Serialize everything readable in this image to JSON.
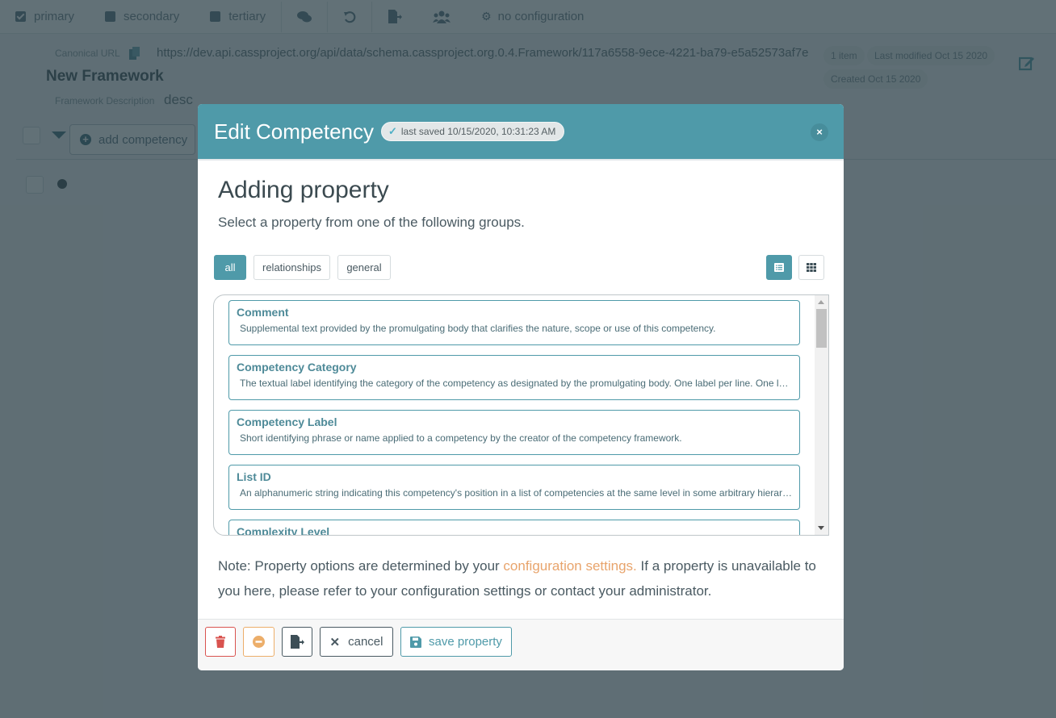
{
  "topbar": {
    "items": [
      {
        "label": "primary",
        "icon": "checkbox-checked-icon"
      },
      {
        "label": "secondary",
        "icon": "checkbox-icon"
      },
      {
        "label": "tertiary",
        "icon": "checkbox-icon"
      }
    ],
    "comments_icon": "comments-icon",
    "undo_icon": "undo-icon",
    "export_icon": "file-export-icon",
    "users_icon": "users-icon",
    "config_label": "no configuration"
  },
  "framework": {
    "canonical_label": "Canonical URL",
    "canonical_url": "https://dev.api.cassproject.org/api/data/schema.cassproject.org.0.4.Framework/117a6558-9ece-4221-ba79-e5a52573af7e",
    "title": "New Framework",
    "description_label": "Framework Description",
    "description": "desc",
    "item_count": "1 item",
    "last_modified": "Last modified Oct 15 2020",
    "created": "Created Oct 15 2020"
  },
  "list_toolbar": {
    "add_competency_label": "add competency"
  },
  "modal": {
    "title": "Edit Competency",
    "saved_badge": "last saved 10/15/2020, 10:31:23 AM",
    "close_label": "×",
    "heading": "Adding property",
    "subheading": "Select a property from one of the following groups.",
    "filters": [
      {
        "label": "all",
        "active": true
      },
      {
        "label": "relationships",
        "active": false
      },
      {
        "label": "general",
        "active": false
      }
    ],
    "view_modes": [
      {
        "name": "list",
        "active": true
      },
      {
        "name": "grid",
        "active": false
      }
    ],
    "properties": [
      {
        "name": "Comment",
        "description": "Supplemental text provided by the promulgating body that clarifies the nature, scope or use of this competency."
      },
      {
        "name": "Competency Category",
        "description": "The textual label identifying the category of the competency as designated by the promulgating body. One label per line. One label per line. One label per line."
      },
      {
        "name": "Competency Label",
        "description": "Short identifying phrase or name applied to a competency by the creator of the competency framework."
      },
      {
        "name": "List ID",
        "description": "An alphanumeric string indicating this competency's position in a list of competencies at the same level in some arbitrary hierarchy."
      },
      {
        "name": "Complexity Level",
        "description": ""
      }
    ],
    "note_prefix": "Note: Property options are determined by your ",
    "note_link": "configuration settings.",
    "note_suffix": " If a property is unavailable to you here, please refer to your configuration settings or contact your administrator.",
    "footer": {
      "cancel_label": "cancel",
      "save_label": "save property"
    }
  },
  "colors": {
    "accent": "#4f9aa9",
    "danger": "#d9534f",
    "warning": "#ecae6a",
    "link": "#e8a46c"
  }
}
